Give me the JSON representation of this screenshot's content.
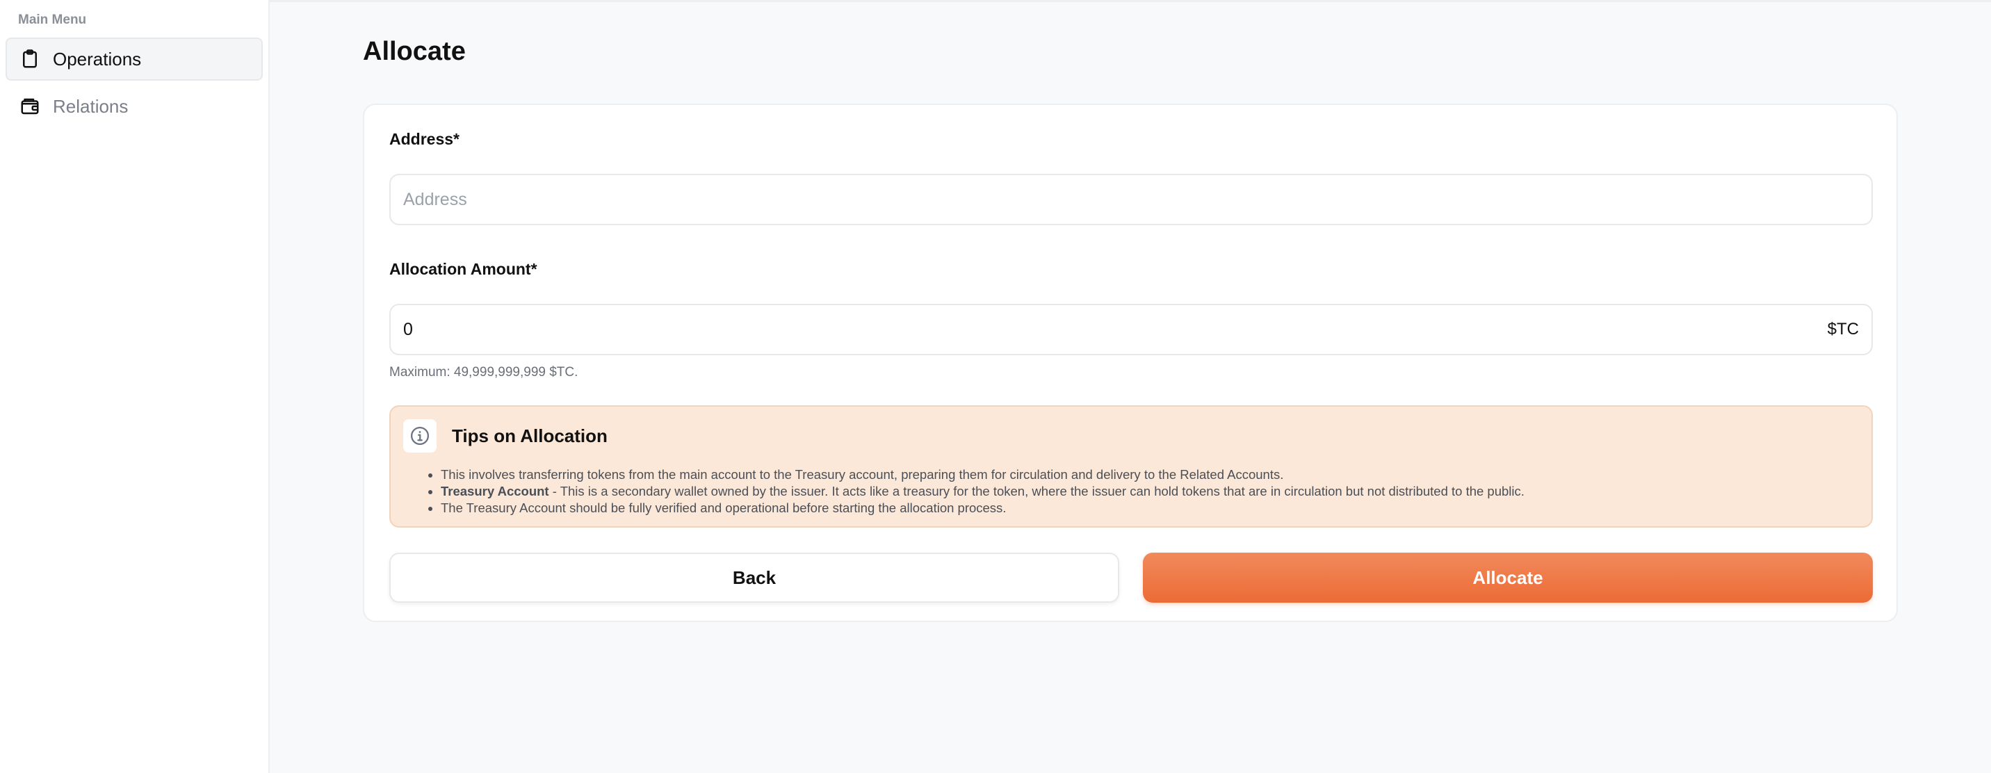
{
  "sidebar": {
    "heading": "Main Menu",
    "items": [
      {
        "label": "Operations",
        "icon": "clipboard-icon",
        "active": true
      },
      {
        "label": "Relations",
        "icon": "wallet-icon",
        "active": false
      }
    ]
  },
  "page": {
    "title": "Allocate"
  },
  "form": {
    "address": {
      "label": "Address*",
      "placeholder": "Address",
      "value": ""
    },
    "amount": {
      "label": "Allocation Amount*",
      "value": "0",
      "suffix": "$TC",
      "hint": "Maximum: 49,999,999,999 $TC."
    }
  },
  "tips": {
    "title": "Tips on Allocation",
    "icon": "info-icon",
    "item1": "This involves transferring tokens from the main account to the Treasury account, preparing them for circulation and delivery to the Related Accounts.",
    "item2_bold": "Treasury Account",
    "item2_rest": " - This is a secondary wallet owned by the issuer. It acts like a treasury for the token, where the issuer can hold tokens that are in circulation but not distributed to the public.",
    "item3": "The Treasury Account should be fully verified and operational before starting the allocation process."
  },
  "actions": {
    "back_label": "Back",
    "allocate_label": "Allocate"
  },
  "colors": {
    "accent": "#ec6b36",
    "tips_bg": "#fbe8d8"
  }
}
